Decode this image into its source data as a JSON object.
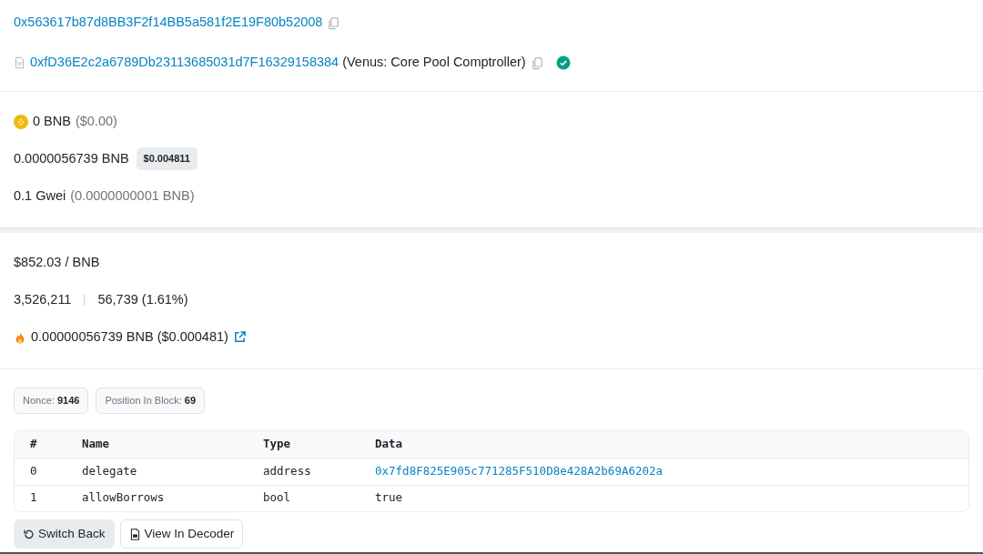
{
  "to_address": "0x563617b87d8BB3F2f14BB5a581f2E19F80b52008",
  "contract": {
    "address": "0xfD36E2c2a6789Db23113685031d7F16329158384",
    "label": "(Venus: Core Pool Comptroller)",
    "verified": true
  },
  "value": {
    "amount": "0 BNB",
    "usd": "($0.00)"
  },
  "fee": {
    "amount": "0.0000056739 BNB",
    "usd": "$0.004811"
  },
  "gas_price": {
    "amount": "0.1 Gwei",
    "detail": "(0.0000000001 BNB)"
  },
  "price": "$852.03 / BNB",
  "gas": {
    "limit": "3,526,211",
    "used": "56,739 (1.61%)"
  },
  "burnt": "0.00000056739 BNB ($0.000481)",
  "attributes": [
    {
      "label": "Nonce:",
      "value": "9146"
    },
    {
      "label": "Position In Block:",
      "value": "69"
    }
  ],
  "input_table": {
    "columns": [
      "#",
      "Name",
      "Type",
      "Data"
    ],
    "rows": [
      {
        "cells": [
          "0",
          "delegate",
          "address",
          "0x7fd8F825E905c771285F510D8e428A2b69A6202a"
        ],
        "kind": "link"
      },
      {
        "cells": [
          "1",
          "allowBorrows",
          "bool",
          "true"
        ],
        "kind": "plain"
      }
    ]
  },
  "buttons": [
    {
      "label": "Switch Back",
      "kind": "switch"
    },
    {
      "label": "View In Decoder",
      "kind": "decoder"
    }
  ]
}
